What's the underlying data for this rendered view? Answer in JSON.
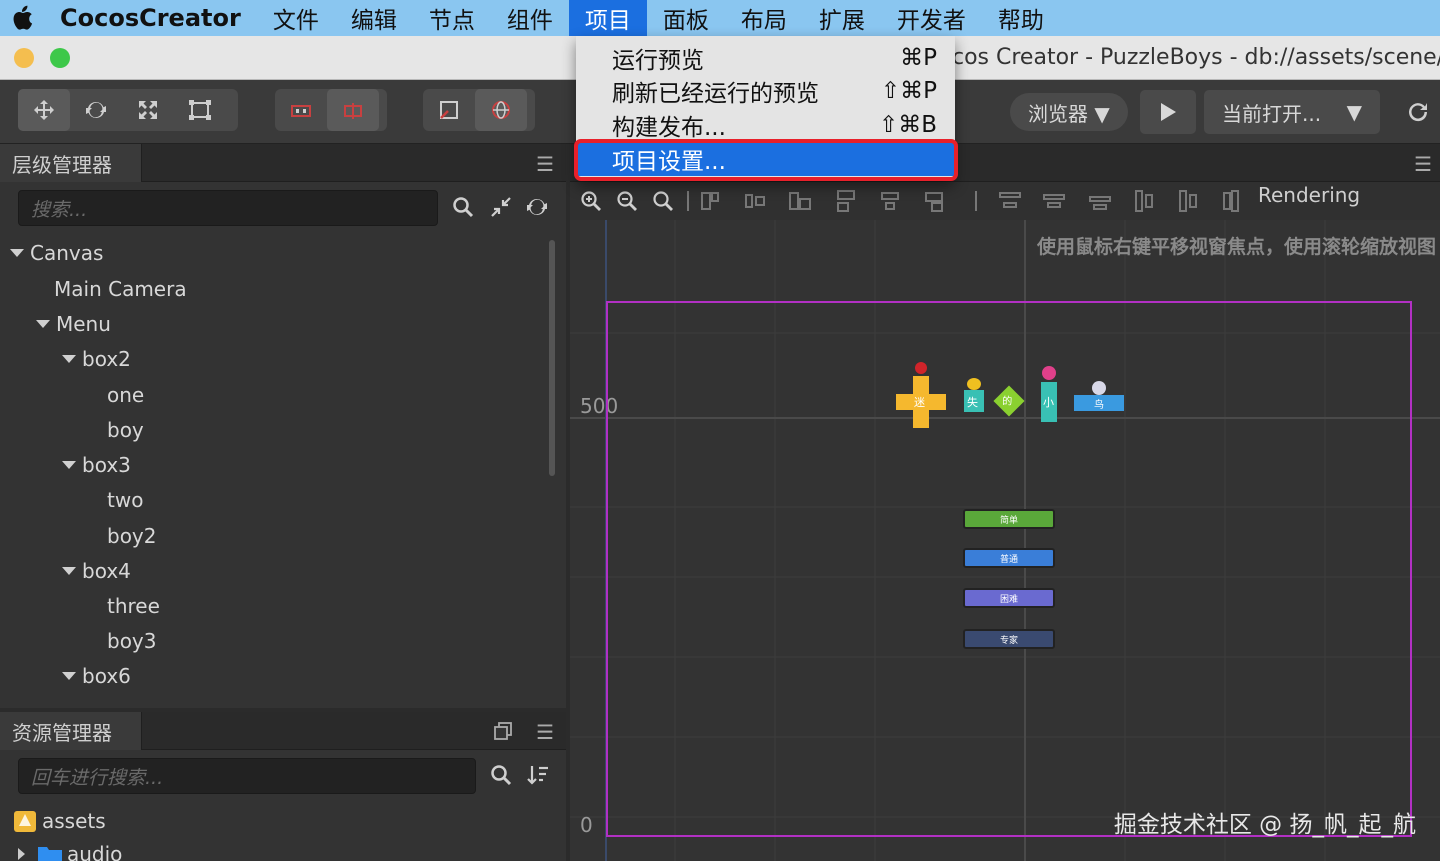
{
  "menubar": {
    "app_name": "CocosCreator",
    "menus": [
      "文件",
      "编辑",
      "节点",
      "组件",
      "项目",
      "面板",
      "布局",
      "扩展",
      "开发者",
      "帮助"
    ],
    "active_menu": "项目"
  },
  "window": {
    "title": "cos Creator - PuzzleBoys - db://assets/scene/"
  },
  "toolbar": {
    "browser_label": "浏览器 ▼",
    "current_open_label": "当前打开...",
    "dropdown_caret": "▼"
  },
  "project_menu": {
    "items": [
      {
        "label": "运行预览",
        "shortcut": "⌘P"
      },
      {
        "label": "刷新已经运行的预览",
        "shortcut": "⇧⌘P"
      },
      {
        "label": "构建发布...",
        "shortcut": "⇧⌘B"
      },
      {
        "label": "项目设置...",
        "shortcut": ""
      }
    ],
    "selected_index": 3
  },
  "hierarchy": {
    "title": "层级管理器",
    "search_placeholder": "搜索...",
    "nodes": [
      {
        "label": "Canvas",
        "depth": 0,
        "expanded": true
      },
      {
        "label": "Main Camera",
        "depth": 1,
        "expanded": false
      },
      {
        "label": "Menu",
        "depth": 1,
        "expanded": true
      },
      {
        "label": "box2",
        "depth": 2,
        "expanded": true
      },
      {
        "label": "one",
        "depth": 3,
        "expanded": false
      },
      {
        "label": "boy",
        "depth": 3,
        "expanded": false
      },
      {
        "label": "box3",
        "depth": 2,
        "expanded": true
      },
      {
        "label": "two",
        "depth": 3,
        "expanded": false
      },
      {
        "label": "boy2",
        "depth": 3,
        "expanded": false
      },
      {
        "label": "box4",
        "depth": 2,
        "expanded": true
      },
      {
        "label": "three",
        "depth": 3,
        "expanded": false
      },
      {
        "label": "boy3",
        "depth": 3,
        "expanded": false
      },
      {
        "label": "box6",
        "depth": 2,
        "expanded": true
      }
    ]
  },
  "assets": {
    "title": "资源管理器",
    "search_placeholder": "回车进行搜索...",
    "items": [
      {
        "label": "assets"
      },
      {
        "label": "audio"
      }
    ]
  },
  "scene": {
    "rendering_label": "Rendering",
    "hint": "使用鼠标右键平移视窗焦点，使用滚轮缩放视图",
    "axis_500": "500",
    "axis_0": "0",
    "title_chars": [
      "迷",
      "失",
      "的",
      "小",
      "鸟"
    ],
    "buttons": [
      {
        "label": "简单",
        "color": "#5aa83a"
      },
      {
        "label": "普通",
        "color": "#3a7ed8"
      },
      {
        "label": "困难",
        "color": "#6a6ad0"
      },
      {
        "label": "专家",
        "color": "#3a4a70"
      }
    ]
  },
  "watermark": "掘金技术社区 @ 扬_帆_起_航",
  "colors": {
    "menubar_bg": "#8ac6f0",
    "menu_active": "#1b6fe0",
    "highlight_red": "#e8202a",
    "design_rect": "#b230c4"
  }
}
